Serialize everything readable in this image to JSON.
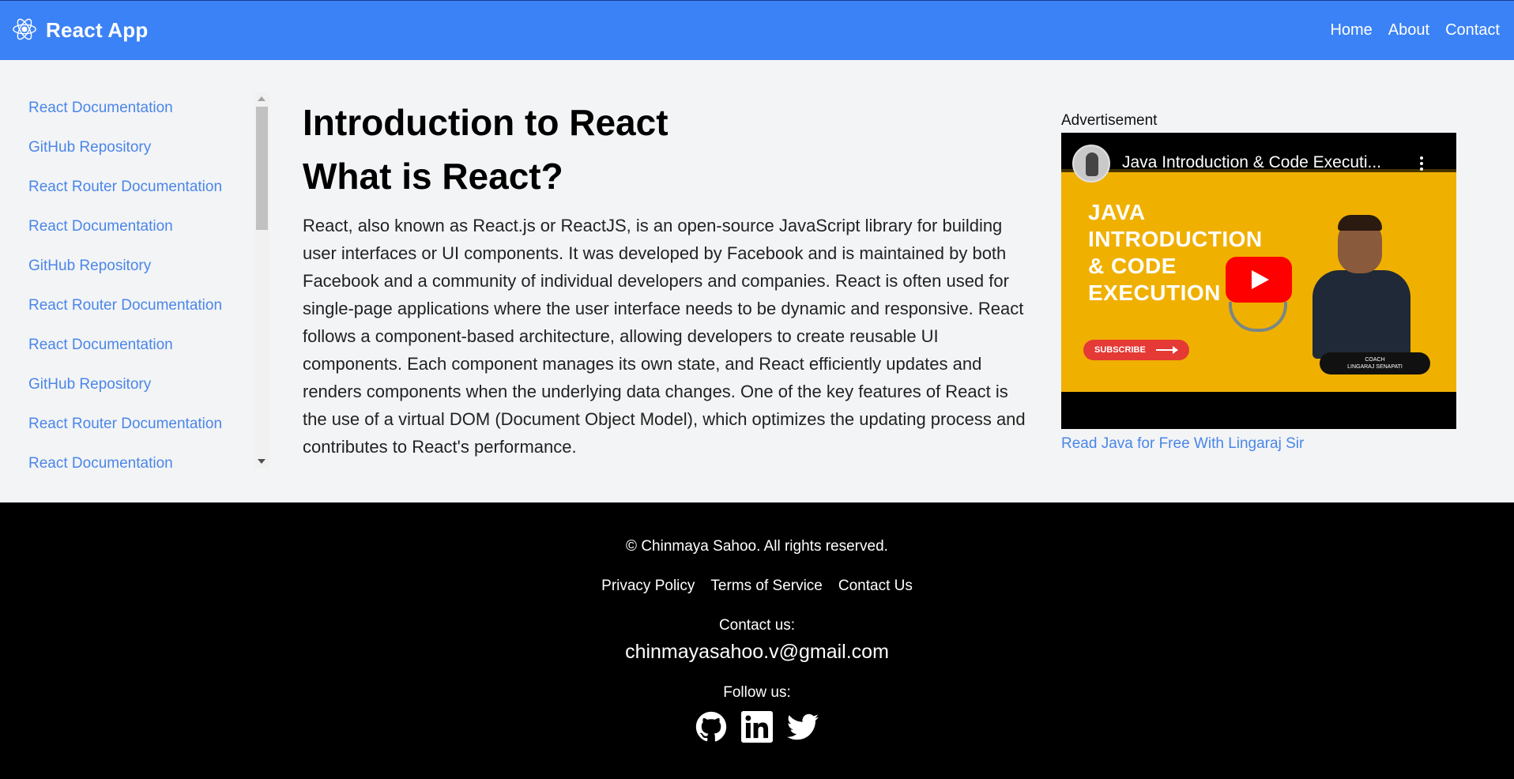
{
  "header": {
    "brand": "React App",
    "nav": [
      {
        "label": "Home"
      },
      {
        "label": "About"
      },
      {
        "label": "Contact"
      }
    ]
  },
  "sidebar": {
    "items": [
      {
        "label": "React Documentation"
      },
      {
        "label": "GitHub Repository"
      },
      {
        "label": "React Router Documentation"
      },
      {
        "label": "React Documentation"
      },
      {
        "label": "GitHub Repository"
      },
      {
        "label": "React Router Documentation"
      },
      {
        "label": "React Documentation"
      },
      {
        "label": "GitHub Repository"
      },
      {
        "label": "React Router Documentation"
      },
      {
        "label": "React Documentation"
      }
    ]
  },
  "main": {
    "title": "Introduction to React",
    "subtitle": "What is React?",
    "paragraph": "React, also known as React.js or ReactJS, is an open-source JavaScript library for building user interfaces or UI components. It was developed by Facebook and is maintained by both Facebook and a community of individual developers and companies. React is often used for single-page applications where the user interface needs to be dynamic and responsive. React follows a component-based architecture, allowing developers to create reusable UI components. Each component manages its own state, and React efficiently updates and renders components when the underlying data changes. One of the key features of React is the use of a virtual DOM (Document Object Model), which optimizes the updating process and contributes to React's performance."
  },
  "ad": {
    "label": "Advertisement",
    "video_title": "Java Introduction & Code Executi...",
    "thumbnail_lines": [
      "JAVA",
      "INTRODUCTION",
      "& CODE",
      "EXECUTION"
    ],
    "subscribe": "SUBSCRIBE",
    "coach_line1": "COACH",
    "coach_line2": "LINGARAJ SENAPATI",
    "link": "Read Java for Free With Lingaraj Sir"
  },
  "footer": {
    "copyright": "© Chinmaya Sahoo. All rights reserved.",
    "links": [
      {
        "label": "Privacy Policy"
      },
      {
        "label": "Terms of Service"
      },
      {
        "label": "Contact Us"
      }
    ],
    "contact_label": "Contact us:",
    "email": "chinmayasahoo.v@gmail.com",
    "follow_label": "Follow us:",
    "social_icons": [
      "github-icon",
      "linkedin-icon",
      "twitter-icon"
    ]
  },
  "colors": {
    "navbar": "#3b82f6",
    "link": "#4a86e8",
    "page_bg": "#f3f4f6",
    "footer_bg": "#000000"
  }
}
